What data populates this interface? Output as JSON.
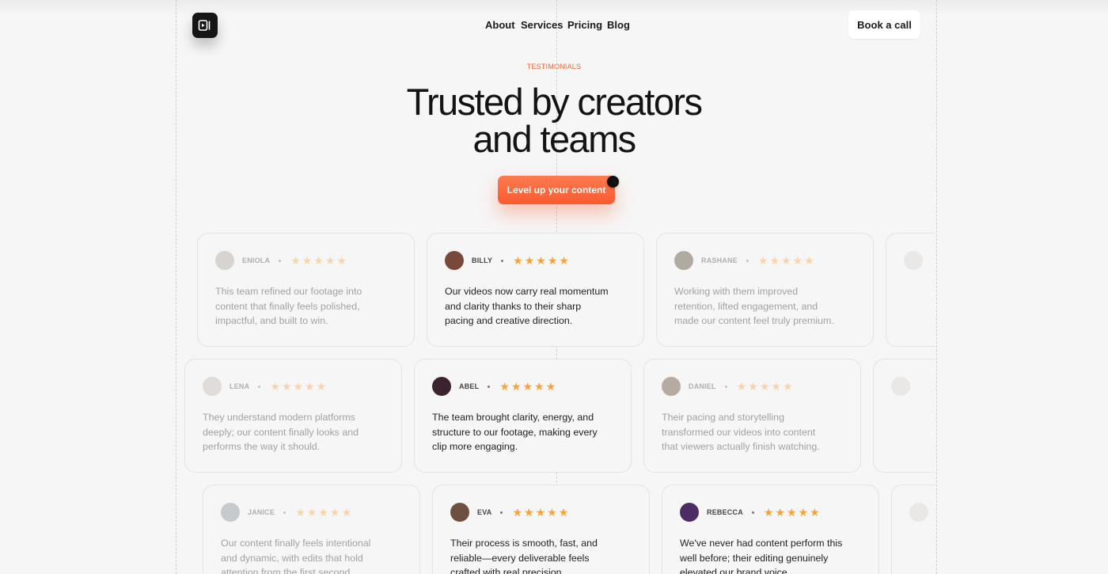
{
  "nav": {
    "links": [
      "About",
      "Services",
      "Pricing",
      "Blog"
    ],
    "cta": "Book a call"
  },
  "hero": {
    "eyebrow": "TESTIMONIALS",
    "headline_line1": "Trusted by creators",
    "headline_line2": "and teams",
    "button": "Level up your content"
  },
  "colors": {
    "accent": "#f9612f",
    "star": "#f9a23a",
    "background": "#f6f6f6"
  },
  "testimonials": [
    {
      "name": "ENIOLA",
      "rating": 5,
      "avatar": "#a9a29a",
      "quote": "This team refined our footage into content that finally feels polished, impactful, and built to win."
    },
    {
      "name": "BILLY",
      "rating": 5,
      "avatar": "#7a4838",
      "quote": "Our videos now carry real momentum and clarity thanks to their sharp pacing and creative direction."
    },
    {
      "name": "RASHANE",
      "rating": 5,
      "avatar": "#4a3a22",
      "quote": "Working with them improved retention, lifted engagement, and made our content feel truly premium."
    },
    {
      "name": "LENA",
      "rating": 5,
      "avatar": "#c2b6ab",
      "quote": "They understand modern platforms deeply; our content finally looks and performs the way it should."
    },
    {
      "name": "ABEL",
      "rating": 5,
      "avatar": "#3b2430",
      "quote": "The team brought clarity, energy, and structure to our footage, making every clip more engaging."
    },
    {
      "name": "DANIEL",
      "rating": 5,
      "avatar": "#5b3a22",
      "quote": "Their pacing and storytelling transformed our videos into content that viewers actually finish watching."
    },
    {
      "name": "JANICE",
      "rating": 5,
      "avatar": "#7b8a95",
      "quote": "Our content finally feels intentional and dynamic, with edits that hold attention from the first second."
    },
    {
      "name": "EVA",
      "rating": 5,
      "avatar": "#6d5040",
      "quote": "Their process is smooth, fast, and reliable—every deliverable feels crafted with real precision."
    },
    {
      "name": "REBECCA",
      "rating": 5,
      "avatar": "#4d2c66",
      "quote": "We've never had content perform this well before; their editing genuinely elevated our brand voice."
    }
  ]
}
